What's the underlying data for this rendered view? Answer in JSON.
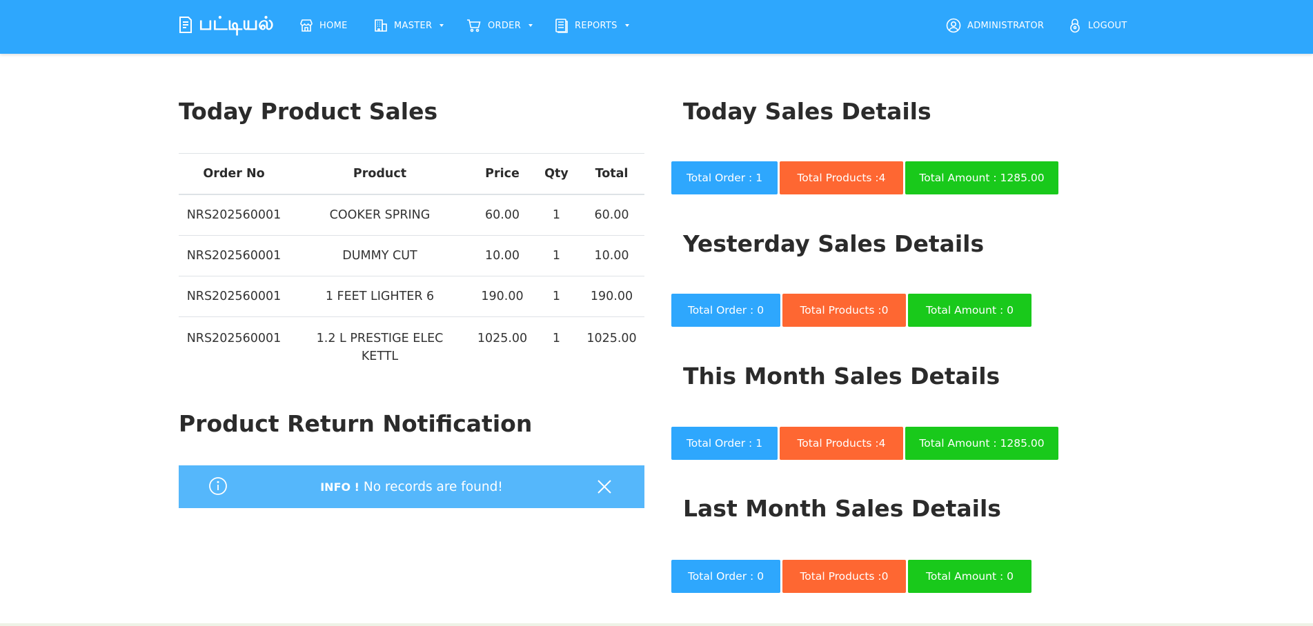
{
  "navbar": {
    "brand": "பட்டியல்",
    "home": "HOME",
    "master": "MASTER",
    "order": "ORDER",
    "reports": "REPORTS",
    "user": "ADMINISTRATOR",
    "logout": "LOGOUT",
    "bg_color": "#2ea7fd"
  },
  "product_sales": {
    "title": "Today Product Sales",
    "columns": [
      "Order No",
      "Product",
      "Price",
      "Qty",
      "Total"
    ],
    "rows": [
      {
        "order_no": "NRS202560001",
        "product": "COOKER SPRING",
        "price": "60.00",
        "qty": "1",
        "total": "60.00"
      },
      {
        "order_no": "NRS202560001",
        "product": "DUMMY CUT",
        "price": "10.00",
        "qty": "1",
        "total": "10.00"
      },
      {
        "order_no": "NRS202560001",
        "product": "1 FEET LIGHTER 6",
        "price": "190.00",
        "qty": "1",
        "total": "190.00"
      },
      {
        "order_no": "NRS202560001",
        "product_line1": "1.2 L PRESTIGE ELEC",
        "product_line2": "KETTL",
        "price": "1025.00",
        "qty": "1",
        "total": "1025.00"
      }
    ]
  },
  "return_notification": {
    "title": "Product Return Notification",
    "alert_prefix": "INFO !",
    "alert_message": "No records are found!"
  },
  "today": {
    "title": "Today Sales Details",
    "total_order": "Total Order : 1",
    "total_products": "Total Products :4",
    "total_amount": "Total Amount : 1285.00"
  },
  "yesterday": {
    "title": "Yesterday Sales Details",
    "total_order": "Total Order : 0",
    "total_products": "Total Products :0",
    "total_amount": "Total Amount : 0"
  },
  "this_month": {
    "title": "This Month Sales Details",
    "total_order": "Total Order : 1",
    "total_products": "Total Products :4",
    "total_amount": "Total Amount : 1285.00"
  },
  "last_month": {
    "title": "Last Month Sales Details",
    "total_order": "Total Order : 0",
    "total_products": "Total Products :0",
    "total_amount": "Total Amount : 0"
  },
  "colors": {
    "blue": "#2ea7fd",
    "orange": "#fe6732",
    "green": "#19c91b",
    "info": "#55b7fb"
  }
}
